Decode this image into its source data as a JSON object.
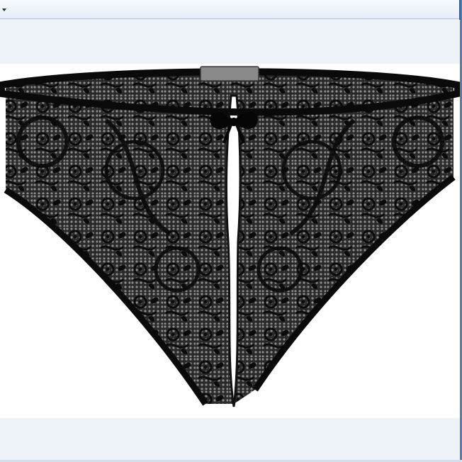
{
  "toolbar": {
    "dropdown_icon": "chevron-down-icon"
  },
  "image": {
    "subject": "black-lace-brief-photo",
    "colors": {
      "lace": "#141414",
      "background": "#ffffff",
      "label_tag": "#8a8a8a",
      "frame_blue": "#4d7fbb",
      "band": "#eef3fa"
    }
  }
}
